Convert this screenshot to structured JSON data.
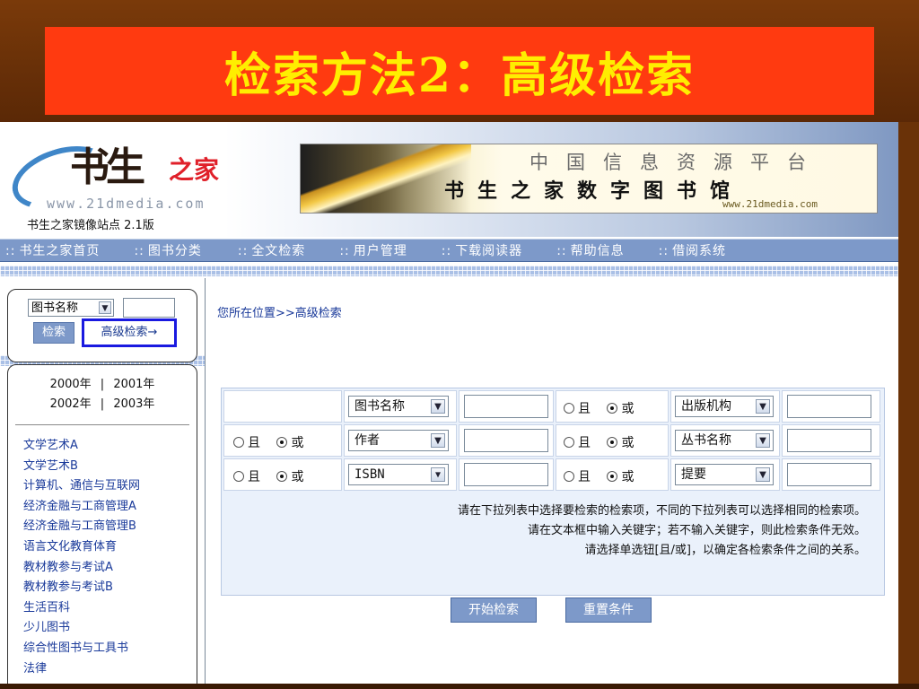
{
  "slide": {
    "title": "检索方法2：高级检索"
  },
  "header": {
    "logo_text": "书生",
    "logo_suffix": "之家",
    "logo_url": "www.21dmedia.com",
    "mirror_label": "书生之家镜像站点 2.1版",
    "banner_line1": "中国信息资源平台",
    "banner_line2": "书生之家数字图书馆",
    "banner_url": "www.21dmedia.com"
  },
  "nav": {
    "items": [
      {
        "label": "书生之家首页"
      },
      {
        "label": "图书分类"
      },
      {
        "label": "全文检索"
      },
      {
        "label": "用户管理"
      },
      {
        "label": "下载阅读器"
      },
      {
        "label": "帮助信息"
      },
      {
        "label": "借阅系统"
      }
    ],
    "prefix": "::"
  },
  "sidebar": {
    "search_select": "图书名称",
    "search_button": "检索",
    "advanced_link": "高级检索→",
    "years": [
      "2000年",
      "2001年",
      "2002年",
      "2003年"
    ],
    "year_separator": "|",
    "categories": [
      "文学艺术A",
      "文学艺术B",
      "计算机、通信与互联网",
      "经济金融与工商管理A",
      "经济金融与工商管理B",
      "语言文化教育体育",
      "教材教参与考试A",
      "教材教参与考试B",
      "生活百科",
      "少儿图书",
      "综合性图书与工具书",
      "法律"
    ]
  },
  "main": {
    "breadcrumb": "您所在位置>>高级检索",
    "rows": [
      {
        "field_left": "图书名称",
        "field_right": "出版机构"
      },
      {
        "field_left": "作者",
        "field_right": "丛书名称"
      },
      {
        "field_left": "ISBN",
        "field_right": "提要"
      }
    ],
    "radio_and": "且",
    "radio_or": "或",
    "notes": [
      "请在下拉列表中选择要检索的检索项，不同的下拉列表可以选择相同的检索项。",
      "请在文本框中输入关键字；若不输入关键字，则此检索条件无效。",
      "请选择单选钮[且/或]，以确定各检索条件之间的关系。"
    ],
    "start_button": "开始检索",
    "reset_button": "重置条件"
  },
  "colors": {
    "title_bg": "#ff3a10",
    "title_text": "#ffee00",
    "nav_bg": "#7d99c9",
    "link": "#1a3a9a",
    "highlight_box": "#1a1ae0"
  }
}
